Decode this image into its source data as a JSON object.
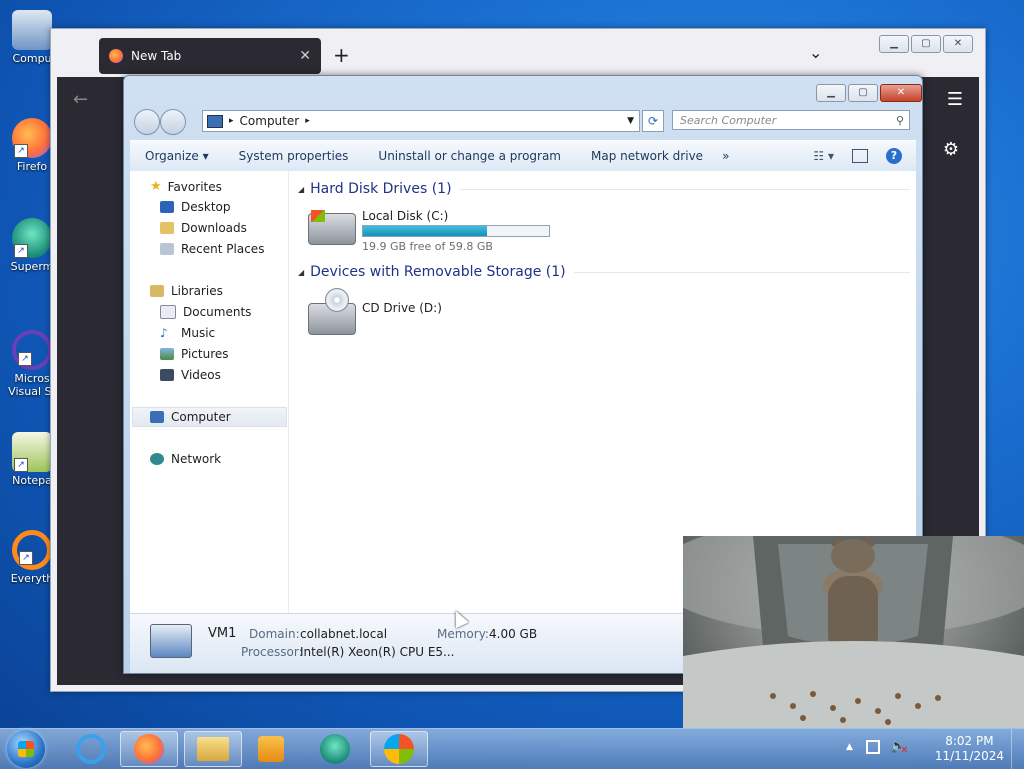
{
  "desktop_icons": [
    {
      "label": "Compu",
      "icon": "computer-icon"
    },
    {
      "label": "Firefo",
      "icon": "firefox-icon"
    },
    {
      "label": "Superm",
      "icon": "supermium-icon"
    },
    {
      "label": "Micros Visual St",
      "icon": "visual-studio-icon"
    },
    {
      "label": "Notepa",
      "icon": "notepad-plus-plus-icon"
    },
    {
      "label": "Everyth",
      "icon": "everything-search-icon"
    }
  ],
  "firefox": {
    "tab_title": "New Tab",
    "tab_close": "✕",
    "new_tab": "+",
    "list_tabs": "⌄"
  },
  "explorer": {
    "address": {
      "crumb": "Computer",
      "sep1": "▸",
      "sep2": "▸"
    },
    "search_placeholder": "Search Computer",
    "toolbar": {
      "organize": "Organize ▾",
      "system_properties": "System properties",
      "uninstall": "Uninstall or change a program",
      "map_drive": "Map network drive",
      "more": "»",
      "help": "?"
    },
    "nav": {
      "favorites": "Favorites",
      "desktop": "Desktop",
      "downloads": "Downloads",
      "recent": "Recent Places",
      "libraries": "Libraries",
      "documents": "Documents",
      "music": "Music",
      "pictures": "Pictures",
      "videos": "Videos",
      "computer": "Computer",
      "network": "Network"
    },
    "groups": {
      "hdd_title": "Hard Disk Drives (1)",
      "removable_title": "Devices with Removable Storage (1)"
    },
    "drives": {
      "c_name": "Local Disk (C:)",
      "c_free": "19.9 GB free of 59.8 GB",
      "c_used_fraction": 0.667,
      "d_name": "CD Drive (D:)"
    },
    "details": {
      "name": "VM1",
      "domain_label": "Domain:",
      "domain_value": "collabnet.local",
      "memory_label": "Memory:",
      "memory_value": "4.00 GB",
      "processor_label": "Processor:",
      "processor_value": "Intel(R) Xeon(R) CPU E5..."
    }
  },
  "taskbar": {
    "clock_time": "8:02 PM",
    "clock_date": "11/11/2024",
    "tray_arrow": "▲"
  },
  "colors": {
    "accent": "#1e3287",
    "disk_bar": "#1b90b6",
    "firefox_dark": "#2b2a33"
  }
}
